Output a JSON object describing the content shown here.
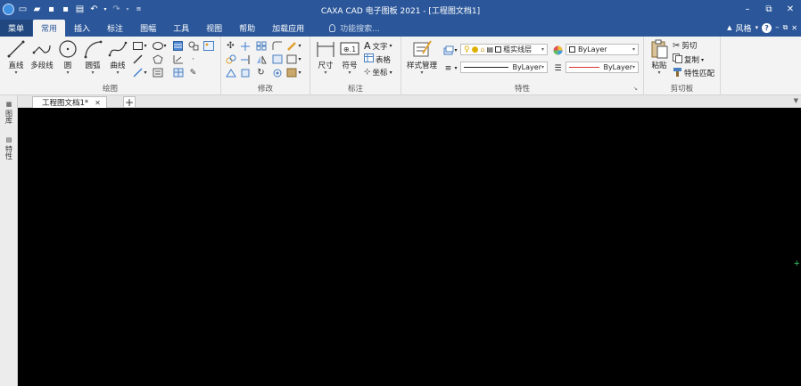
{
  "window": {
    "title": "CAXA CAD 电子图板 2021 - [工程图文档1]",
    "controls": [
      "–",
      "⧉",
      "✕"
    ]
  },
  "tabs": [
    {
      "label": "菜单",
      "name": "menu",
      "active": false
    },
    {
      "label": "常用",
      "name": "common",
      "active": true
    },
    {
      "label": "插入",
      "name": "insert",
      "active": false
    },
    {
      "label": "标注",
      "name": "annotate",
      "active": false
    },
    {
      "label": "图幅",
      "name": "sheet",
      "active": false
    },
    {
      "label": "工具",
      "name": "tools",
      "active": false
    },
    {
      "label": "视图",
      "name": "view",
      "active": false
    },
    {
      "label": "帮助",
      "name": "help",
      "active": false
    },
    {
      "label": "加载应用",
      "name": "load-app",
      "active": false
    }
  ],
  "search": {
    "placeholder": "功能搜索..."
  },
  "style_selector": {
    "label": "风格",
    "arrow": "▾"
  },
  "right_controls": {
    "help": "?",
    "minimize": "–",
    "restore": "⧉",
    "close": "✕"
  },
  "ribbon": {
    "draw": {
      "label": "绘图",
      "buttons": [
        {
          "label": "直线",
          "name": "line"
        },
        {
          "label": "多段线",
          "name": "polyline"
        },
        {
          "label": "圆",
          "name": "circle"
        },
        {
          "label": "圆弧",
          "name": "arc"
        },
        {
          "label": "曲线",
          "name": "curve"
        }
      ]
    },
    "modify": {
      "label": "修改"
    },
    "annotation": {
      "label": "标注",
      "buttons": [
        {
          "label": "尺寸",
          "name": "dimension"
        },
        {
          "label": "符号",
          "name": "symbol"
        }
      ],
      "small": [
        {
          "label": "文字",
          "name": "text"
        },
        {
          "label": "表格",
          "name": "table"
        },
        {
          "label": "坐标",
          "name": "coordinate"
        }
      ]
    },
    "properties": {
      "label": "特性",
      "style_manager": "样式管理",
      "layer_name": "粗实线层",
      "color": "ByLayer",
      "linetype": "ByLayer",
      "lineweight": "ByLayer"
    },
    "clipboard": {
      "label": "剪切板",
      "paste": "粘贴",
      "cut": "剪切",
      "copy": "复制",
      "match": "特性匹配"
    }
  },
  "document": {
    "tab_label": "工程图文档1*",
    "close": "✕",
    "new_tab": "+"
  },
  "side_panel": {
    "tabs": [
      "图库",
      "特性"
    ]
  },
  "colors": {
    "titlebar": "#2b579a",
    "canvas": "#000000",
    "accent": "#2b579a"
  }
}
